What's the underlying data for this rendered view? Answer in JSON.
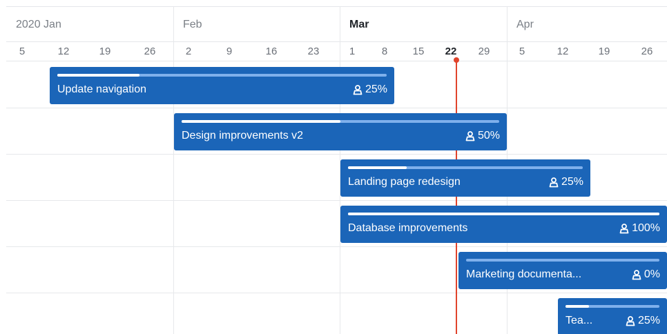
{
  "timeline": {
    "months": [
      {
        "label": "2020 Jan",
        "current": false
      },
      {
        "label": "Feb",
        "current": false
      },
      {
        "label": "Mar",
        "current": true
      },
      {
        "label": "Apr",
        "current": false
      }
    ],
    "weeks": [
      "5",
      "12",
      "19",
      "26",
      "2",
      "9",
      "16",
      "23",
      "1",
      "8",
      "15",
      "22",
      "29",
      "5",
      "12",
      "19",
      "26"
    ],
    "today_week": "22",
    "tasks": [
      {
        "name": "Update navigation",
        "percent": "25%",
        "progress": 0.25
      },
      {
        "name": "Design improvements v2",
        "percent": "50%",
        "progress": 0.5
      },
      {
        "name": "Landing page redesign",
        "percent": "25%",
        "progress": 0.25
      },
      {
        "name": "Database improvements",
        "percent": "100%",
        "progress": 1.0
      },
      {
        "name": "Marketing documenta...",
        "percent": "0%",
        "progress": 0.0
      },
      {
        "name": "Tea...",
        "percent": "25%",
        "progress": 0.25
      }
    ]
  },
  "colors": {
    "bar": "#1b65b8",
    "track": "#7fb0ec",
    "today": "#e0432b",
    "grid": "#e6e8eb"
  },
  "icons": {
    "assignee": "person-icon"
  }
}
